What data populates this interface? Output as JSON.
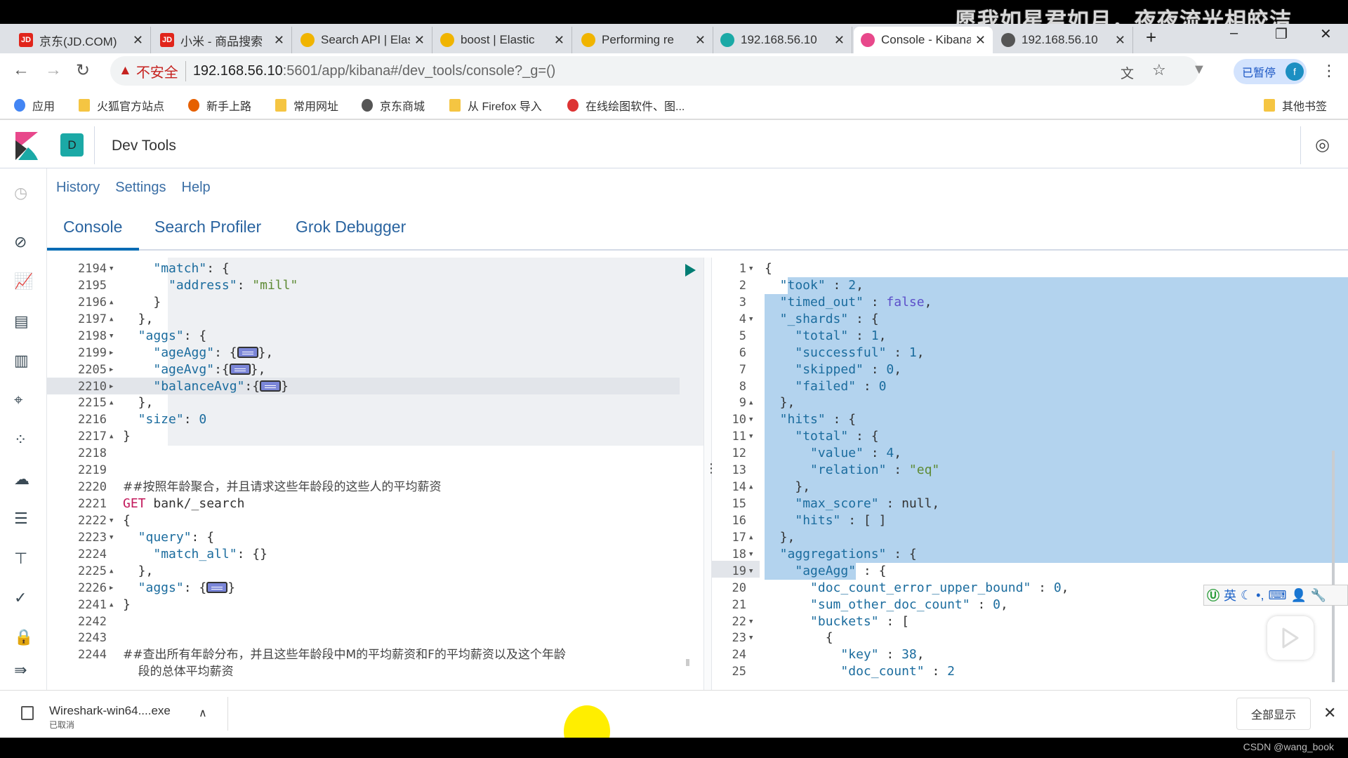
{
  "watermark": "愿我如星君如月，夜夜流光相皎洁",
  "browser": {
    "tabs": [
      {
        "title": "京东(JD.COM)",
        "icon": "jd-icon",
        "color": "#e1251b",
        "active": false
      },
      {
        "title": "小米 - 商品搜索",
        "icon": "jd-icon",
        "color": "#e1251b",
        "active": false
      },
      {
        "title": "Search API | Elastic",
        "icon": "elastic-icon",
        "color": "#f0b400",
        "active": false
      },
      {
        "title": "boost | Elastic",
        "icon": "elastic-icon",
        "color": "#f0b400",
        "active": false
      },
      {
        "title": "Performing re",
        "icon": "elastic-icon",
        "color": "#f0b400",
        "active": false
      },
      {
        "title": "192.168.56.10",
        "icon": "elastic-cluster-icon",
        "color": "#1ba9a6",
        "active": false
      },
      {
        "title": "Console - Kibana",
        "icon": "kibana-icon",
        "color": "#e8488b",
        "active": true
      },
      {
        "title": "192.168.56.10",
        "icon": "globe-icon",
        "color": "#555555",
        "active": false
      }
    ],
    "new_tab": "+",
    "url": {
      "insecure_label": "不安全",
      "host": "192.168.56.10",
      "path": ":5601/app/kibana#/dev_tools/console?_g=()"
    },
    "paused_label": "已暂停",
    "avatar_letter": "f",
    "bookmarks": [
      {
        "label": "应用",
        "icon": "apps-icon"
      },
      {
        "label": "火狐官方站点",
        "icon": "folder-icon"
      },
      {
        "label": "新手上路",
        "icon": "firefox-icon"
      },
      {
        "label": "常用网址",
        "icon": "folder-icon"
      },
      {
        "label": "京东商城",
        "icon": "globe-icon"
      },
      {
        "label": "从 Firefox 导入",
        "icon": "folder-icon"
      },
      {
        "label": "在线绘图软件、图...",
        "icon": "drawio-icon"
      }
    ],
    "other_bookmarks": "其他书签"
  },
  "kibana": {
    "space_badge": "D",
    "app_title": "Dev Tools",
    "links": [
      "History",
      "Settings",
      "Help"
    ],
    "tabs": [
      {
        "label": "Console",
        "active": true
      },
      {
        "label": "Search Profiler",
        "active": false
      },
      {
        "label": "Grok Debugger",
        "active": false
      }
    ],
    "accent": "#006bb4"
  },
  "request_editor": {
    "lines": [
      {
        "n": "2194",
        "f": "open",
        "i": 2,
        "t": [
          [
            "k",
            "\"match\""
          ],
          [
            "p",
            ": {"
          ]
        ]
      },
      {
        "n": "2195",
        "f": "",
        "i": 3,
        "t": [
          [
            "k",
            "\"address\""
          ],
          [
            "p",
            ": "
          ],
          [
            "s",
            "\"mill\""
          ]
        ]
      },
      {
        "n": "2196",
        "f": "close",
        "i": 2,
        "t": [
          [
            "p",
            "}"
          ]
        ]
      },
      {
        "n": "2197",
        "f": "close",
        "i": 1,
        "t": [
          [
            "p",
            "},"
          ]
        ]
      },
      {
        "n": "2198",
        "f": "open",
        "i": 1,
        "t": [
          [
            "k",
            "\"aggs\""
          ],
          [
            "p",
            ": {"
          ]
        ]
      },
      {
        "n": "2199",
        "f": "collapsed",
        "i": 2,
        "t": [
          [
            "k",
            "\"ageAgg\""
          ],
          [
            "p",
            ": {"
          ],
          [
            "fold",
            "…"
          ],
          [
            "p",
            "},"
          ]
        ]
      },
      {
        "n": "2205",
        "f": "collapsed",
        "i": 2,
        "t": [
          [
            "k",
            "\"ageAvg\""
          ],
          [
            "p",
            ":{"
          ],
          [
            "fold",
            "…"
          ],
          [
            "p",
            "},"
          ]
        ]
      },
      {
        "n": "2210",
        "f": "collapsed",
        "i": 2,
        "t": [
          [
            "k",
            "\"balanceAvg\""
          ],
          [
            "p",
            ":{"
          ],
          [
            "fold",
            "…"
          ],
          [
            "p",
            "}"
          ]
        ]
      },
      {
        "n": "2215",
        "f": "close",
        "i": 1,
        "t": [
          [
            "p",
            "},"
          ]
        ]
      },
      {
        "n": "2216",
        "f": "",
        "i": 1,
        "t": [
          [
            "k",
            "\"size\""
          ],
          [
            "p",
            ": "
          ],
          [
            "n",
            "0"
          ]
        ]
      },
      {
        "n": "2217",
        "f": "close",
        "i": 0,
        "t": [
          [
            "p",
            "}"
          ]
        ]
      },
      {
        "n": "2218",
        "f": "",
        "i": 0,
        "t": []
      },
      {
        "n": "2219",
        "f": "",
        "i": 0,
        "t": []
      },
      {
        "n": "2220",
        "f": "",
        "i": 0,
        "t": [
          [
            "c",
            "##按照年龄聚合，并且请求这些年龄段的这些人的平均薪资"
          ]
        ]
      },
      {
        "n": "2221",
        "f": "",
        "i": 0,
        "t": [
          [
            "kw",
            "GET "
          ],
          [
            "pl",
            "bank/_search"
          ]
        ]
      },
      {
        "n": "2222",
        "f": "open",
        "i": 0,
        "t": [
          [
            "p",
            "{"
          ]
        ]
      },
      {
        "n": "2223",
        "f": "open",
        "i": 1,
        "t": [
          [
            "k",
            "\"query\""
          ],
          [
            "p",
            ": {"
          ]
        ]
      },
      {
        "n": "2224",
        "f": "",
        "i": 2,
        "t": [
          [
            "k",
            "\"match_all\""
          ],
          [
            "p",
            ": {}"
          ]
        ]
      },
      {
        "n": "2225",
        "f": "close",
        "i": 1,
        "t": [
          [
            "p",
            "},"
          ]
        ]
      },
      {
        "n": "2226",
        "f": "collapsed",
        "i": 1,
        "t": [
          [
            "k",
            "\"aggs\""
          ],
          [
            "p",
            ": {"
          ],
          [
            "fold",
            "…"
          ],
          [
            "p",
            "}"
          ]
        ]
      },
      {
        "n": "2241",
        "f": "close",
        "i": 0,
        "t": [
          [
            "p",
            "}"
          ]
        ]
      },
      {
        "n": "2242",
        "f": "",
        "i": 0,
        "t": []
      },
      {
        "n": "2243",
        "f": "",
        "i": 0,
        "t": []
      },
      {
        "n": "2244",
        "f": "",
        "i": 0,
        "t": [
          [
            "c",
            "##查出所有年龄分布，并且这些年龄段中M的平均薪资和F的平均薪资以及这个年龄"
          ]
        ]
      },
      {
        "n": "",
        "f": "",
        "i": 1,
        "t": [
          [
            "c",
            "段的总体平均薪资"
          ]
        ]
      }
    ]
  },
  "response_editor": {
    "lines": [
      {
        "n": "1",
        "f": "open",
        "i": 0,
        "t": [
          [
            "p",
            "{"
          ]
        ]
      },
      {
        "n": "2",
        "f": "",
        "i": 1,
        "t": [
          [
            "k",
            "\"took\""
          ],
          [
            "p",
            " : "
          ],
          [
            "n",
            "2"
          ],
          [
            "p",
            ","
          ]
        ]
      },
      {
        "n": "3",
        "f": "",
        "i": 1,
        "t": [
          [
            "k",
            "\"timed_out\""
          ],
          [
            "p",
            " : "
          ],
          [
            "b",
            "false"
          ],
          [
            "p",
            ","
          ]
        ]
      },
      {
        "n": "4",
        "f": "open",
        "i": 1,
        "t": [
          [
            "k",
            "\"_shards\""
          ],
          [
            "p",
            " : {"
          ]
        ]
      },
      {
        "n": "5",
        "f": "",
        "i": 2,
        "t": [
          [
            "k",
            "\"total\""
          ],
          [
            "p",
            " : "
          ],
          [
            "n",
            "1"
          ],
          [
            "p",
            ","
          ]
        ]
      },
      {
        "n": "6",
        "f": "",
        "i": 2,
        "t": [
          [
            "k",
            "\"successful\""
          ],
          [
            "p",
            " : "
          ],
          [
            "n",
            "1"
          ],
          [
            "p",
            ","
          ]
        ]
      },
      {
        "n": "7",
        "f": "",
        "i": 2,
        "t": [
          [
            "k",
            "\"skipped\""
          ],
          [
            "p",
            " : "
          ],
          [
            "n",
            "0"
          ],
          [
            "p",
            ","
          ]
        ]
      },
      {
        "n": "8",
        "f": "",
        "i": 2,
        "t": [
          [
            "k",
            "\"failed\""
          ],
          [
            "p",
            " : "
          ],
          [
            "n",
            "0"
          ]
        ]
      },
      {
        "n": "9",
        "f": "close",
        "i": 1,
        "t": [
          [
            "p",
            "},"
          ]
        ]
      },
      {
        "n": "10",
        "f": "open",
        "i": 1,
        "t": [
          [
            "k",
            "\"hits\""
          ],
          [
            "p",
            " : {"
          ]
        ]
      },
      {
        "n": "11",
        "f": "open",
        "i": 2,
        "t": [
          [
            "k",
            "\"total\""
          ],
          [
            "p",
            " : {"
          ]
        ]
      },
      {
        "n": "12",
        "f": "",
        "i": 3,
        "t": [
          [
            "k",
            "\"value\""
          ],
          [
            "p",
            " : "
          ],
          [
            "n",
            "4"
          ],
          [
            "p",
            ","
          ]
        ]
      },
      {
        "n": "13",
        "f": "",
        "i": 3,
        "t": [
          [
            "k",
            "\"relation\""
          ],
          [
            "p",
            " : "
          ],
          [
            "s",
            "\"eq\""
          ]
        ]
      },
      {
        "n": "14",
        "f": "close",
        "i": 2,
        "t": [
          [
            "p",
            "},"
          ]
        ]
      },
      {
        "n": "15",
        "f": "",
        "i": 2,
        "t": [
          [
            "k",
            "\"max_score\""
          ],
          [
            "p",
            " : null,"
          ]
        ]
      },
      {
        "n": "16",
        "f": "",
        "i": 2,
        "t": [
          [
            "k",
            "\"hits\""
          ],
          [
            "p",
            " : [ ]"
          ]
        ]
      },
      {
        "n": "17",
        "f": "close",
        "i": 1,
        "t": [
          [
            "p",
            "},"
          ]
        ]
      },
      {
        "n": "18",
        "f": "open",
        "i": 1,
        "t": [
          [
            "k",
            "\"aggregations\""
          ],
          [
            "p",
            " : {"
          ]
        ]
      },
      {
        "n": "19",
        "f": "open",
        "i": 2,
        "t": [
          [
            "k",
            "\"ageAgg\""
          ],
          [
            "p",
            " : {"
          ]
        ]
      },
      {
        "n": "20",
        "f": "",
        "i": 3,
        "t": [
          [
            "k",
            "\"doc_count_error_upper_bound\""
          ],
          [
            "p",
            " : "
          ],
          [
            "n",
            "0"
          ],
          [
            "p",
            ","
          ]
        ]
      },
      {
        "n": "21",
        "f": "",
        "i": 3,
        "t": [
          [
            "k",
            "\"sum_other_doc_count\""
          ],
          [
            "p",
            " : "
          ],
          [
            "n",
            "0"
          ],
          [
            "p",
            ","
          ]
        ]
      },
      {
        "n": "22",
        "f": "open",
        "i": 3,
        "t": [
          [
            "k",
            "\"buckets\""
          ],
          [
            "p",
            " : ["
          ]
        ]
      },
      {
        "n": "23",
        "f": "open",
        "i": 4,
        "t": [
          [
            "p",
            "{"
          ]
        ]
      },
      {
        "n": "24",
        "f": "",
        "i": 5,
        "t": [
          [
            "k",
            "\"key\""
          ],
          [
            "p",
            " : "
          ],
          [
            "n",
            "38"
          ],
          [
            "p",
            ","
          ]
        ]
      },
      {
        "n": "25",
        "f": "",
        "i": 5,
        "t": [
          [
            "k",
            "\"doc_count\""
          ],
          [
            "p",
            " : "
          ],
          [
            "n",
            "2"
          ]
        ]
      }
    ]
  },
  "ime": {
    "lang": "英"
  },
  "download": {
    "file": "Wireshark-win64....exe",
    "status": "已取消",
    "show_all": "全部显示"
  },
  "footer_credit": "CSDN @wang_book"
}
